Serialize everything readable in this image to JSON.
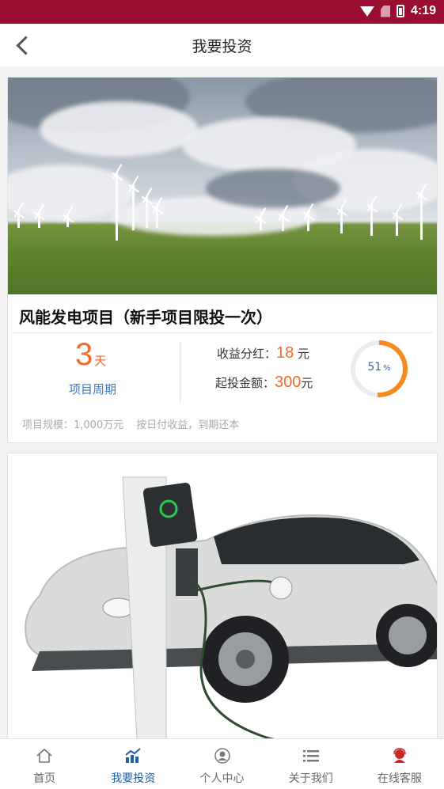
{
  "status_bar": {
    "time": "4:19"
  },
  "header": {
    "title": "我要投资"
  },
  "projects": [
    {
      "title": "风能发电项目（新手项目限投一次）",
      "period_value": "3",
      "period_unit": "天",
      "period_label": "项目周期",
      "yield_label": "收益分红：",
      "yield_value": "18",
      "yield_unit": "元",
      "min_label": "起投金额：",
      "min_value": "300",
      "min_unit": "元",
      "progress_value": "51",
      "progress_unit": "%",
      "progress_fraction": 0.51,
      "scale_text": "项目规模：1,000万元",
      "payout_text": "按日付收益，到期还本"
    }
  ],
  "tabbar": {
    "items": [
      {
        "label": "首页",
        "icon": "home-icon"
      },
      {
        "label": "我要投资",
        "icon": "chart-icon",
        "active": true
      },
      {
        "label": "个人中心",
        "icon": "user-icon"
      },
      {
        "label": "关于我们",
        "icon": "list-icon"
      },
      {
        "label": "在线客服",
        "icon": "support-icon"
      }
    ]
  },
  "colors": {
    "status_bar": "#9b0d2e",
    "accent_orange": "#f36a2a",
    "accent_blue": "#1f5ea8"
  }
}
